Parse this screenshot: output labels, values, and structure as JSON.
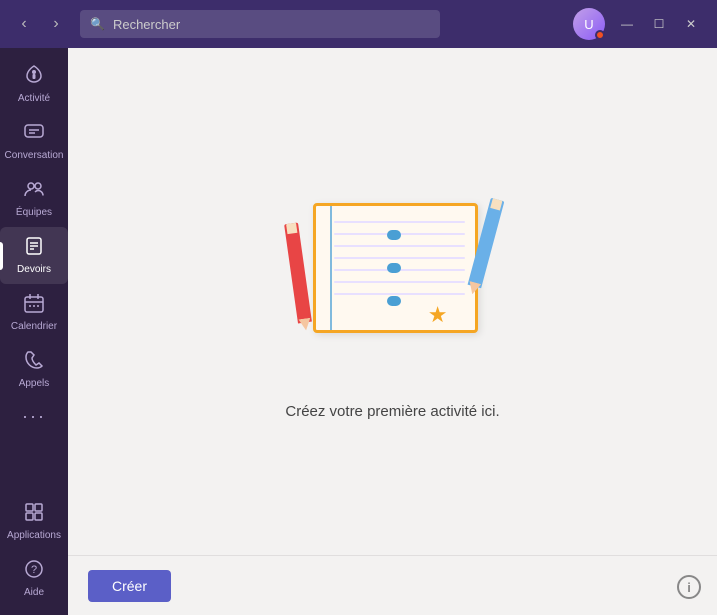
{
  "titlebar": {
    "search_placeholder": "Rechercher",
    "nav_back": "‹",
    "nav_forward": "›",
    "btn_minimize": "—",
    "btn_maximize": "☐",
    "btn_close": "✕"
  },
  "sidebar": {
    "items": [
      {
        "id": "activite",
        "label": "Activité",
        "icon": "🔔"
      },
      {
        "id": "conversation",
        "label": "Conversation",
        "icon": "💬"
      },
      {
        "id": "equipes",
        "label": "Équipes",
        "icon": "👥"
      },
      {
        "id": "devoirs",
        "label": "Devoirs",
        "icon": "📋",
        "active": true
      },
      {
        "id": "calendrier",
        "label": "Calendrier",
        "icon": "📅"
      },
      {
        "id": "appels",
        "label": "Appels",
        "icon": "📞"
      }
    ],
    "bottom_items": [
      {
        "id": "applications",
        "label": "Applications",
        "icon": "🔲"
      },
      {
        "id": "aide",
        "label": "Aide",
        "icon": "❓"
      }
    ],
    "more_label": "···"
  },
  "main": {
    "empty_state_text": "Créez votre première activité ici.",
    "create_button_label": "Créer"
  }
}
